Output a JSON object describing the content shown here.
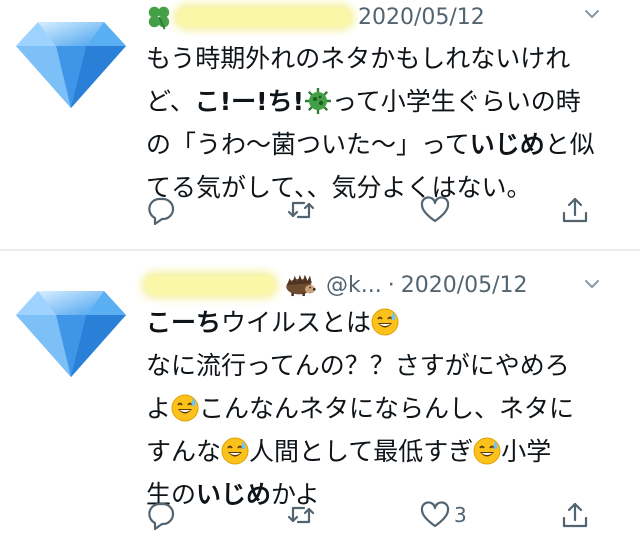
{
  "tweets": [
    {
      "name_prefix_icon": "four-leaf-clover-icon",
      "timestamp": "2020/05/12",
      "body": {
        "line1": "もう時期外れのネタかもしれないけれ",
        "l2_a": "ど、",
        "l2_b": "こ!ー!ち!",
        "l2_c": "って小学生ぐらいの時",
        "l3_a": "の「うわ〜菌ついた〜」って",
        "l3_b": "いじめ",
        "l3_c": "と似",
        "line4": "てる気がして、、気分よくはない。"
      },
      "actions": {
        "like_count": ""
      }
    },
    {
      "name_suffix_icon": "hedgehog-icon",
      "handle": "@k...",
      "separator": "·",
      "timestamp": "2020/05/12",
      "body": {
        "l1_a": "こーち",
        "l1_b": "ウイルスとは",
        "line2": "なに流行ってんの？？さすがにやめろ",
        "l3_a": "よ",
        "l3_b": "こんなんネタにならんし、ネタに",
        "l4_a": "すんな",
        "l4_b": "人間として最低すぎ",
        "l4_c": "小学",
        "l5_a": "生の",
        "l5_b": "いじめ",
        "l5_c": "かよ"
      },
      "actions": {
        "like_count": "3"
      }
    }
  ],
  "icons": {
    "avatar": "diamond-icon",
    "reply": "reply-icon",
    "retweet": "retweet-icon",
    "like": "heart-icon",
    "share": "share-icon",
    "menu": "chevron-down-icon",
    "virus": "virus-icon",
    "sweat": "grinning-sweat-icon"
  },
  "colors": {
    "text": "#0f1419",
    "meta": "#536471",
    "divider": "#e6ecf0",
    "diamond": "#5aa9ee"
  }
}
